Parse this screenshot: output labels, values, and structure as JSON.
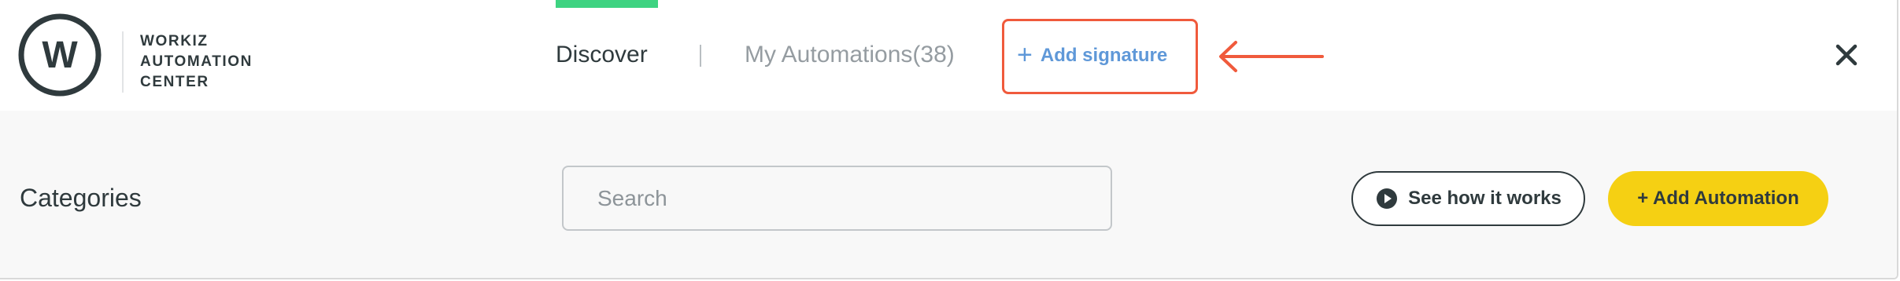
{
  "brand": {
    "logo_letter": "W",
    "name_lines": [
      "WORKIZ",
      "AUTOMATION",
      "CENTER"
    ]
  },
  "tabs": {
    "discover_label": "Discover",
    "my_automations_label": "My Automations(38)",
    "active": "Discover"
  },
  "add_signature": {
    "plus": "+",
    "label": "Add signature"
  },
  "toolbar": {
    "categories_label": "Categories",
    "search_placeholder": "Search",
    "search_value": "",
    "see_how_label": "See how it works",
    "add_automation_label": "+ Add Automation"
  },
  "icons": {
    "logo": "workiz-logo-icon",
    "annotation_arrow": "arrow-left-icon",
    "close": "close-icon",
    "play": "play-circle-icon"
  },
  "colors": {
    "accent_green": "#3ed381",
    "brand_yellow": "#f5d013",
    "link_blue": "#5f98d8",
    "annotation_red": "#f05a3c",
    "text_dark": "#2f3a3d"
  }
}
